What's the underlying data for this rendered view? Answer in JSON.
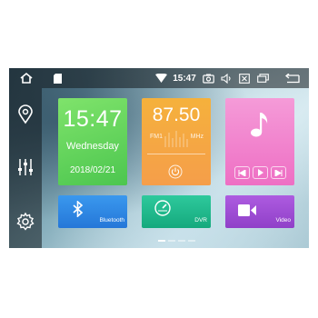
{
  "status_bar": {
    "time": "15:47",
    "icons": [
      "home-icon",
      "sd-card-icon",
      "wifi-icon",
      "camera-icon",
      "volume-icon",
      "close-window-icon",
      "recent-apps-icon",
      "back-icon"
    ]
  },
  "nav": {
    "icons": [
      "location-pin-icon",
      "equalizer-icon",
      "settings-icon"
    ]
  },
  "clock": {
    "time": "15:47",
    "day": "Wednesday",
    "date": "2018/02/21",
    "color": "#5fd35a"
  },
  "radio": {
    "frequency": "87.50",
    "band": "FM1",
    "unit": "MHz",
    "color": "#f3a83e"
  },
  "music": {
    "icon": "music-note-icon",
    "controls": [
      "previous-icon",
      "play-icon",
      "next-icon"
    ],
    "color": "#f07cc9"
  },
  "bluetooth": {
    "label": "Bluetooth",
    "icon": "bluetooth-icon",
    "color": "#2d8fe6"
  },
  "dvr": {
    "label": "DVR",
    "icon": "speedometer-icon",
    "color": "#23b98e"
  },
  "video": {
    "label": "Video",
    "icon": "video-camera-icon",
    "color": "#a24fd6"
  },
  "page_indicator": {
    "pages": 4,
    "active": 1
  }
}
